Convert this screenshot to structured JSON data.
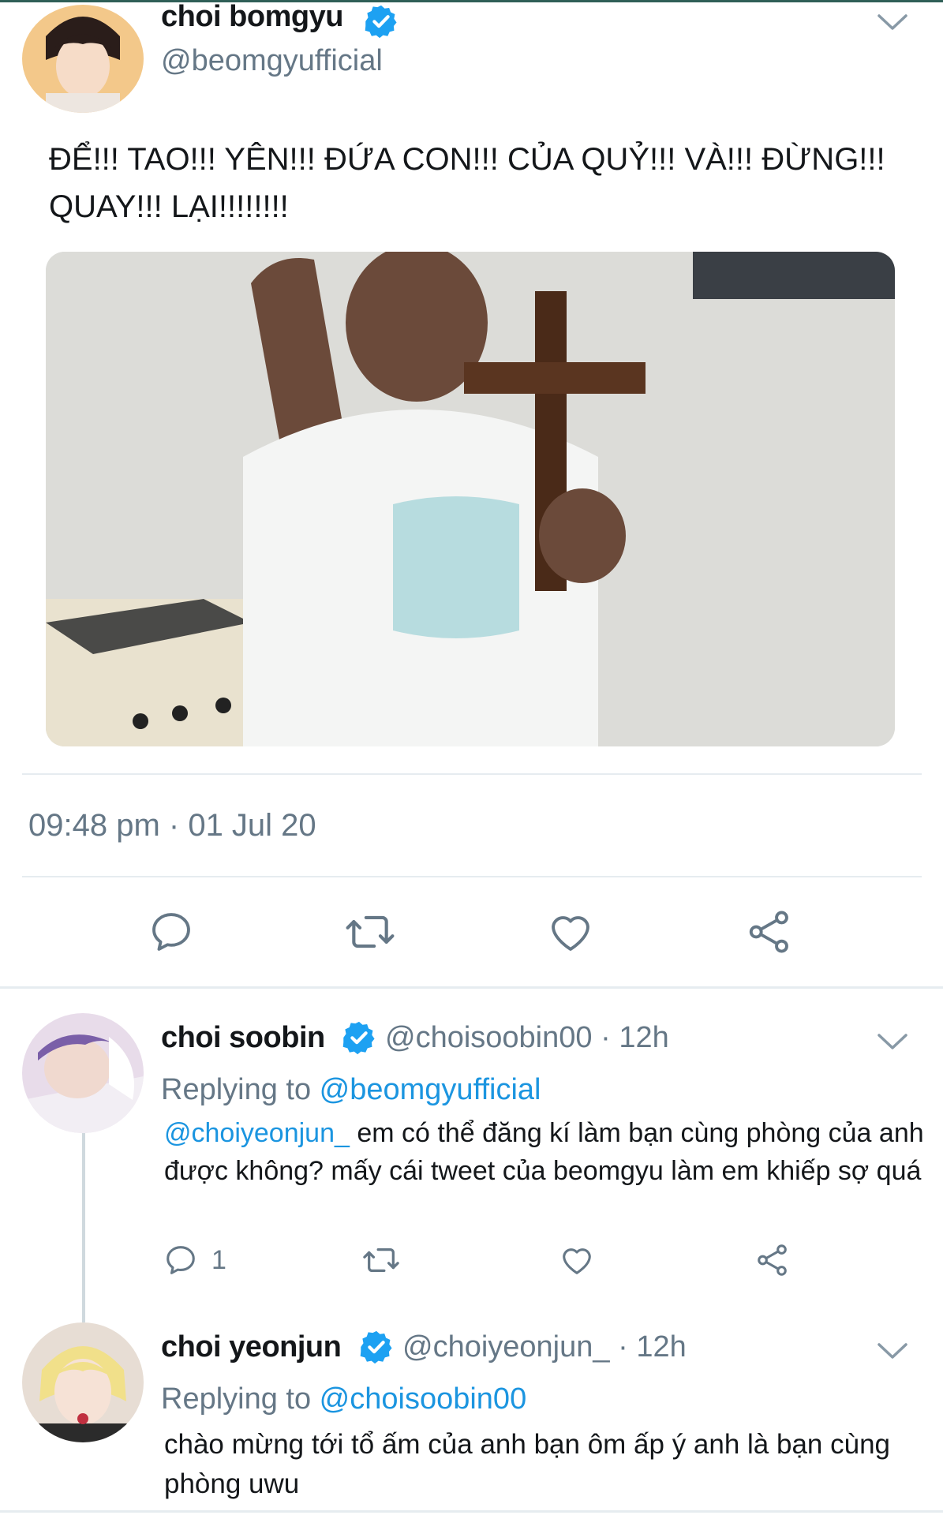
{
  "main_tweet": {
    "author": {
      "name": "choi bomgyu",
      "handle": "@beomgyufficial",
      "verified": true,
      "avatar": "avatar-photo"
    },
    "text": "ĐỂ!!! TAO!!! YÊN!!! ĐỨA CON!!! CỦA QUỶ!!! VÀ!!! ĐỪNG!!! QUAY!!! LẠI!!!!!!!!",
    "media": "photo-child-holding-cross",
    "timestamp": "09:48 pm · 01 Jul 20",
    "actions": [
      "reply-icon",
      "retweet-icon",
      "like-icon",
      "share-icon"
    ]
  },
  "replies": [
    {
      "author": {
        "name": "choi soobin",
        "handle": "@choisoobin00",
        "verified": true,
        "time": "12h"
      },
      "replying_prefix": "Replying to ",
      "replying_to": "@beomgyufficial",
      "mention": "@choiyeonjun_",
      "text": " em có thể đăng kí làm bạn cùng phòng của anh được không? mấy cái tweet của beomgyu làm em khiếp sợ quá",
      "reply_count": "1"
    },
    {
      "author": {
        "name": "choi yeonjun",
        "handle": "@choiyeonjun_",
        "verified": true,
        "time": "12h"
      },
      "replying_prefix": "Replying to ",
      "replying_to": "@choisoobin00",
      "text": "chào mừng tới tổ ấm của anh bạn ôm ấp ý anh là bạn cùng phòng uwu"
    }
  ],
  "colors": {
    "verified": "#1da1f2",
    "link": "#1b95e0",
    "muted": "#657786",
    "icon": "#657786"
  }
}
